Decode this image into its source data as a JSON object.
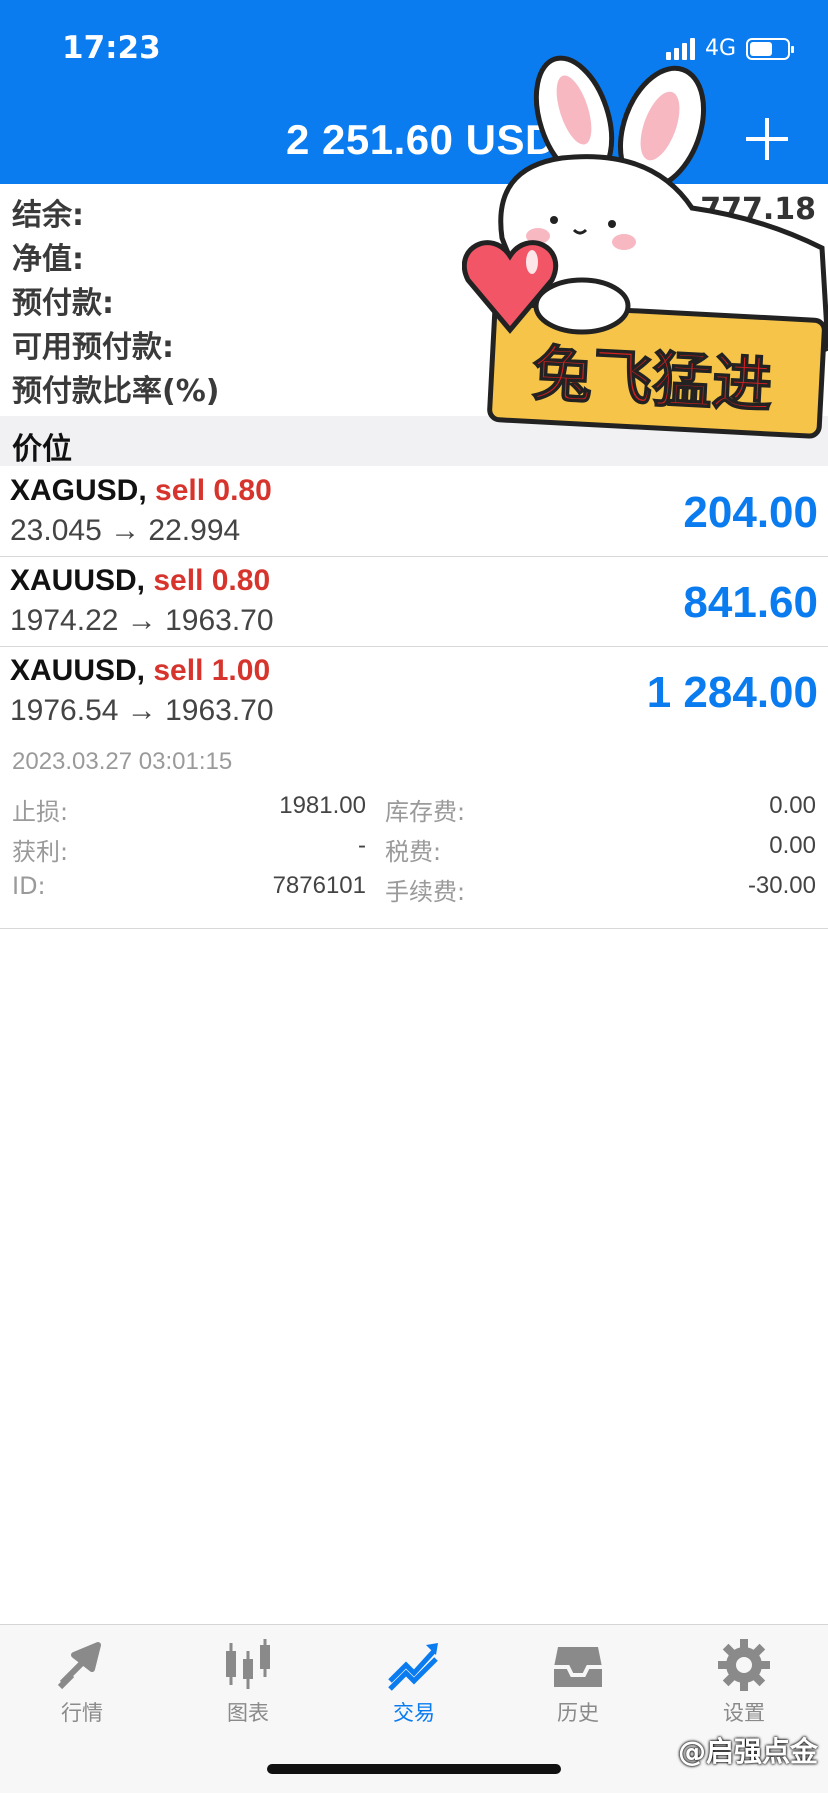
{
  "status_bar": {
    "time": "17:23",
    "network": "4G"
  },
  "header": {
    "title": "2 251.60 USD"
  },
  "summary": {
    "labels": [
      "结余:",
      "净值:",
      "预付款:",
      "可用预付款:",
      "预付款比率(%)"
    ],
    "balance_partial": "777.18"
  },
  "section": {
    "title": "价位"
  },
  "positions": [
    {
      "symbol": "XAGUSD,",
      "side": "sell 0.80",
      "prices": "23.045 → 22.994",
      "profit": "204.00"
    },
    {
      "symbol": "XAUUSD,",
      "side": "sell 0.80",
      "prices": "1974.22 → 1963.70",
      "profit": "841.60"
    },
    {
      "symbol": "XAUUSD,",
      "side": "sell 1.00",
      "prices": "1976.54 → 1963.70",
      "profit": "1 284.00"
    }
  ],
  "details": {
    "time": "2023.03.27 03:01:15",
    "stop_loss_label": "止损:",
    "stop_loss_value": "1981.00",
    "take_profit_label": "获利:",
    "take_profit_value": "-",
    "id_label": "ID:",
    "id_value": "7876101",
    "swap_label": "库存费:",
    "swap_value": "0.00",
    "tax_label": "税费:",
    "tax_value": "0.00",
    "commission_label": "手续费:",
    "commission_value": "-30.00"
  },
  "sticker": {
    "text": "兔飞猛进"
  },
  "tabs": [
    {
      "label": "行情",
      "icon": "quotes-icon"
    },
    {
      "label": "图表",
      "icon": "candlestick-icon"
    },
    {
      "label": "交易",
      "icon": "trade-icon"
    },
    {
      "label": "历史",
      "icon": "history-inbox-icon"
    },
    {
      "label": "设置",
      "icon": "gear-icon"
    }
  ],
  "active_tab": "交易",
  "watermark": "@启强点金",
  "colors": {
    "accent": "#0a7cf0",
    "sell": "#d6342c",
    "header_bg": "#0a7cf0"
  }
}
